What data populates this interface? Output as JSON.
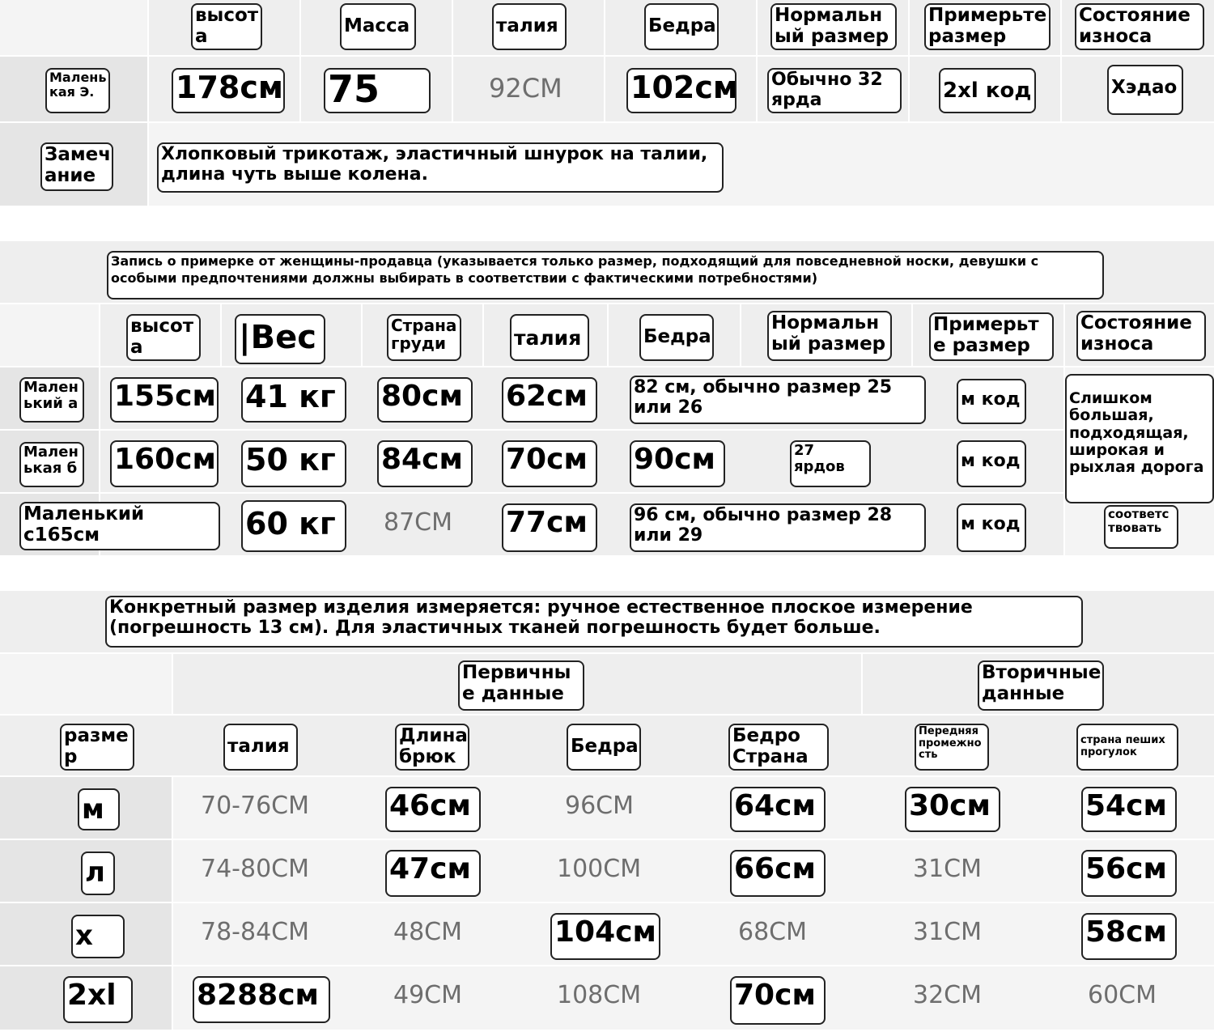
{
  "section1": {
    "headers": [
      "высот а",
      "Масса",
      "талия",
      "Бедра",
      "Нормальн ый размер",
      "Примерьте размер",
      "Состояние износа"
    ],
    "row": {
      "label": "Малень кая Э.",
      "height": "178см",
      "weight": "75 кг",
      "waist": "92CM",
      "hips": "102см",
      "normal_size": "Обычно 32 ярда",
      "try_size": "2xl код",
      "wear": "Хэдао"
    },
    "remark_label": "Замеч ание",
    "remark_text": "Хлопковый трикотаж, эластичный шнурок на талии, длина чуть выше колена."
  },
  "section2": {
    "title": "Запись о примерке от женщины-продавца (указывается только размер, подходящий для повседневной носки, девушки с особыми предпочтениями должны выбирать в соответствии с фактическими потребностями)",
    "headers": [
      "высот а",
      "|Вес",
      "Страна груди",
      "талия",
      "Бедра",
      "Нормальн ый размер",
      "Примерьт е размер",
      "Состояние износа"
    ],
    "rows": [
      {
        "label": "Мален ький а",
        "height": "155см",
        "weight": "41 кг",
        "chest": "80см",
        "waist": "62см",
        "hips_normal": "82 см, обычно размер 25 или 26",
        "try_size": "м код"
      },
      {
        "label": "Мален ькая б",
        "height": "160см",
        "weight": "50 кг",
        "chest": "84см",
        "waist": "70см",
        "hips": "90см",
        "normal": "27 ярдов",
        "try_size": "м код"
      },
      {
        "label": "Маленький с165см",
        "weight": "60 кг",
        "chest": "87CM",
        "waist": "77см",
        "hips_normal": "96 см, обычно размер 28 или 29",
        "try_size": "м код",
        "wear": "соответс твовать"
      }
    ],
    "wear_merged": "Слишком большая, подходящая, широкая и рыхлая дорога"
  },
  "section3": {
    "title": "Конкретный размер изделия измеряется: ручное естественное плоское измерение (погрешность 13 см). Для эластичных тканей погрешность будет больше.",
    "group_primary": "Первичны е данные",
    "group_secondary": "Вторичные данные",
    "headers": [
      "разме р",
      "талия",
      "Длина брюк",
      "Бедра",
      "Бедро Страна",
      "Передняя промежно сть",
      "страна пеших прогулок"
    ],
    "rows": [
      {
        "size": "м",
        "waist": "70-76CM",
        "length": "46см",
        "hips": "96CM",
        "thigh": "64см",
        "rise": "30см",
        "leg": "54см"
      },
      {
        "size": "л",
        "waist": "74-80CM",
        "length": "47см",
        "hips": "100CM",
        "thigh": "66см",
        "rise": "31CM",
        "leg": "56см"
      },
      {
        "size": "х",
        "waist": "78-84CM",
        "length": "48CM",
        "hips": "104см",
        "thigh": "68CM",
        "rise": "31CM",
        "leg": "58см"
      },
      {
        "size": "2xl",
        "waist": "8288см",
        "length": "49CM",
        "hips": "108CM",
        "thigh": "70см",
        "rise": "32CM",
        "leg": "60CM"
      }
    ]
  }
}
